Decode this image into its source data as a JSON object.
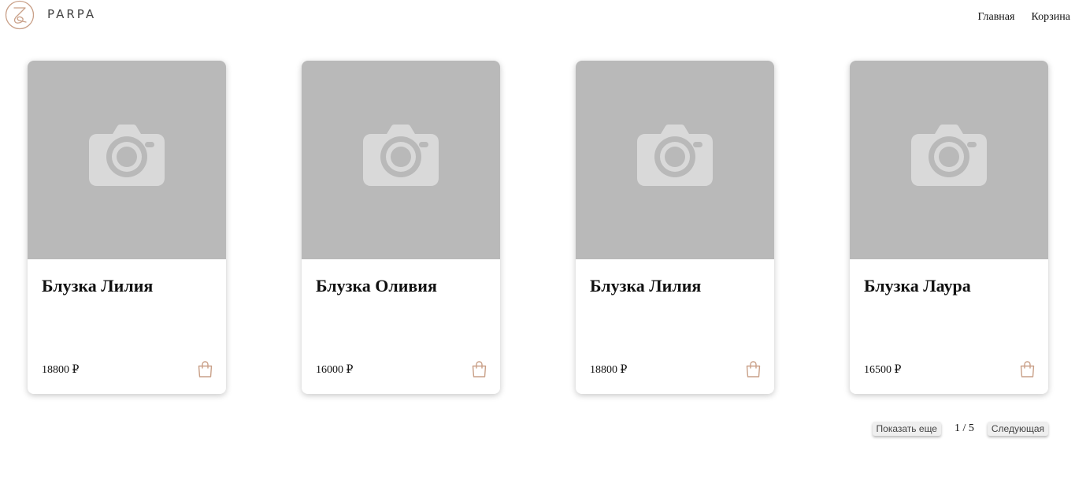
{
  "brand": {
    "name": "PARPA",
    "logo_icon": "monogram-logo"
  },
  "nav": {
    "home": "Главная",
    "cart": "Корзина"
  },
  "products": [
    {
      "title": "Блузка Лилия",
      "price": "18800 ₽",
      "image_icon": "camera-placeholder",
      "cart_icon": "shopping-bag"
    },
    {
      "title": "Блузка Оливия",
      "price": "16000 ₽",
      "image_icon": "camera-placeholder",
      "cart_icon": "shopping-bag"
    },
    {
      "title": "Блузка Лилия",
      "price": "18800 ₽",
      "image_icon": "camera-placeholder",
      "cart_icon": "shopping-bag"
    },
    {
      "title": "Блузка Лаура",
      "price": "16500 ₽",
      "image_icon": "camera-placeholder",
      "cart_icon": "shopping-bag"
    }
  ],
  "pagination": {
    "show_more": "Показать еще",
    "page_info": "1 / 5",
    "next": "Следующая"
  },
  "colors": {
    "accent": "#c9a088",
    "placeholder_bg": "#b9b9b9",
    "placeholder_icon": "#d9d9d9"
  }
}
